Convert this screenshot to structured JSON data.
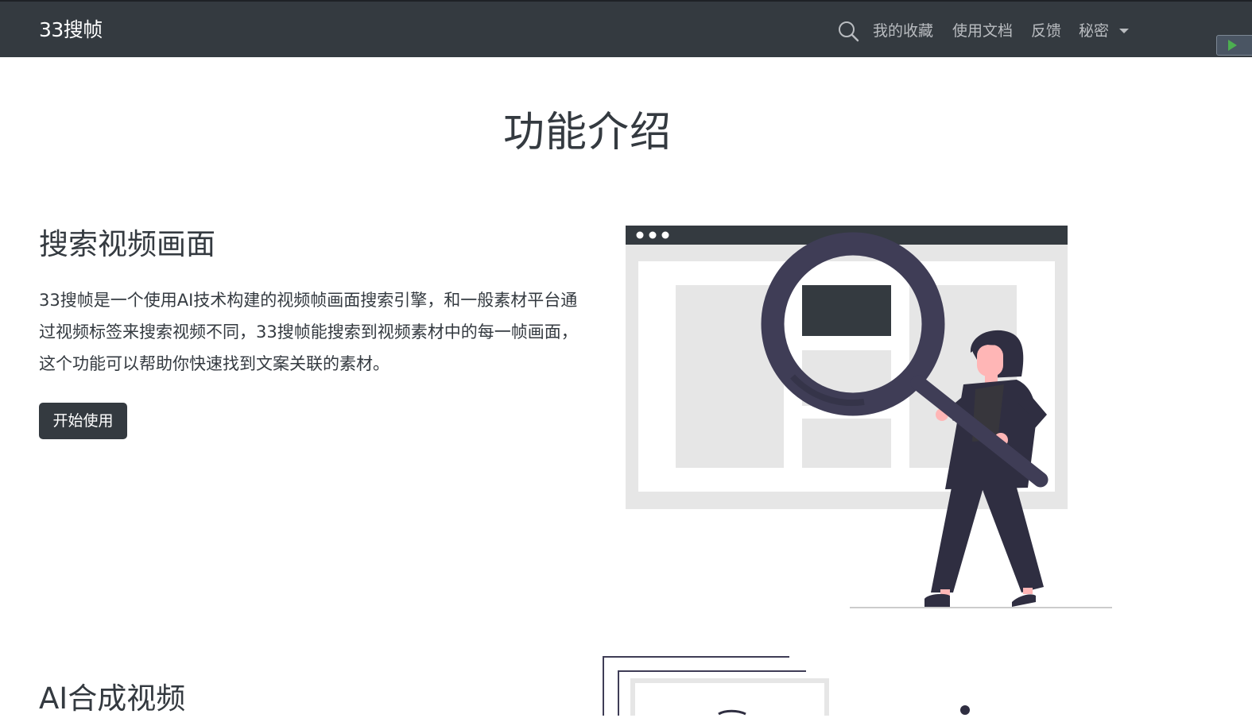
{
  "navbar": {
    "brand": "33搜帧",
    "search_icon": "search-icon",
    "links": [
      "我的收藏",
      "使用文档",
      "反馈",
      "秘密"
    ],
    "dropdown_icon": "caret-down-icon"
  },
  "page": {
    "title": "功能介绍"
  },
  "sections": [
    {
      "title": "搜索视频画面",
      "description": "33搜帧是一个使用AI技术构建的视频帧画面搜索引擎，和一般素材平台通过视频标签来搜索视频不同，33搜帧能搜索到视频素材中的每一帧画面，这个功能可以帮助你快速找到文案关联的素材。",
      "button_label": "开始使用",
      "illustration": "magnifying-glass-person-illustration"
    },
    {
      "title": "AI合成视频",
      "illustration": "video-frames-illustration"
    }
  ],
  "colors": {
    "navbar_bg": "#343a40",
    "text": "#343a40",
    "accent_dark": "#2f2e41",
    "skin": "#ffb6b6",
    "panel_gray": "#e6e6e6"
  }
}
